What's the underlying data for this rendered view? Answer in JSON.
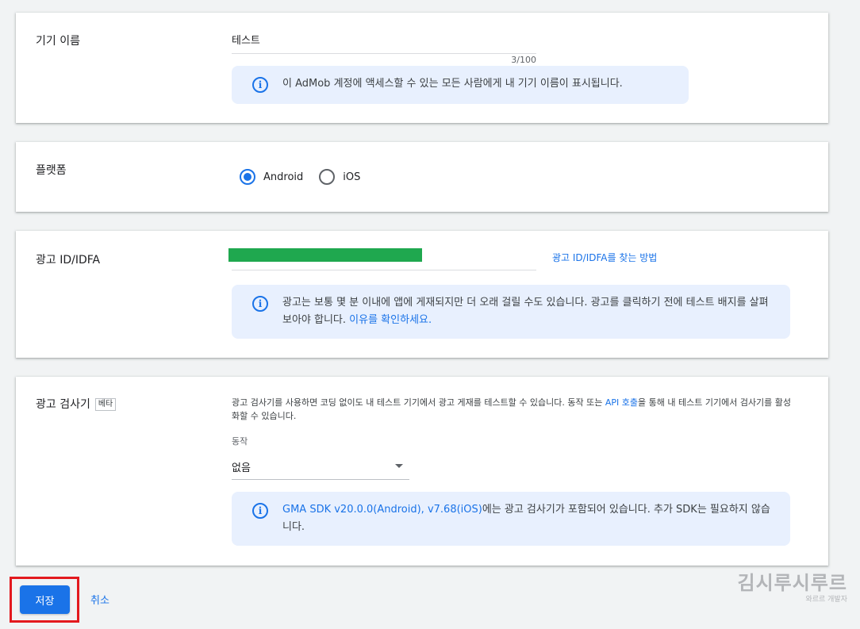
{
  "device_name": {
    "label": "기기 이름",
    "value": "테스트",
    "counter": "3/100",
    "info": "이 AdMob 계정에 액세스할 수 있는 모든 사람에게 내 기기 이름이 표시됩니다."
  },
  "platform": {
    "label": "플랫폼",
    "options": [
      "Android",
      "iOS"
    ],
    "selected": "Android"
  },
  "ad_id": {
    "label": "광고 ID/IDFA",
    "help_link": "광고 ID/IDFA를 찾는 방법",
    "info_text": "광고는 보통 몇 분 이내에 앱에 게재되지만 더 오래 걸릴 수도 있습니다. 광고를 클릭하기 전에 테스트 배지를 살펴보아야 합니다.",
    "info_link": "이유를 확인하세요."
  },
  "ad_inspector": {
    "label": "광고 검사기",
    "badge": "베타",
    "desc_before": "광고 검사기를 사용하면 코딩 없이도 내 테스트 기기에서 광고 게재를 테스트할 수 있습니다. 동작 또는 ",
    "desc_link": "API 호출",
    "desc_after": "을 통해 내 테스트 기기에서 검사기를 활성화할 수 있습니다.",
    "action_label": "동작",
    "action_value": "없음",
    "info_link": "GMA SDK v20.0.0(Android), v7.68(iOS)",
    "info_text": "에는 광고 검사기가 포함되어 있습니다. 추가 SDK는 필요하지 않습니다."
  },
  "actions": {
    "save": "저장",
    "cancel": "취소"
  },
  "watermark": {
    "main": "김시루시루르",
    "sub": "와르르 개발자"
  },
  "colors": {
    "accent": "#1a73e8",
    "info_bg": "#e8f0fe",
    "highlight": "#e3191e",
    "redaction": "#1fa84f"
  }
}
